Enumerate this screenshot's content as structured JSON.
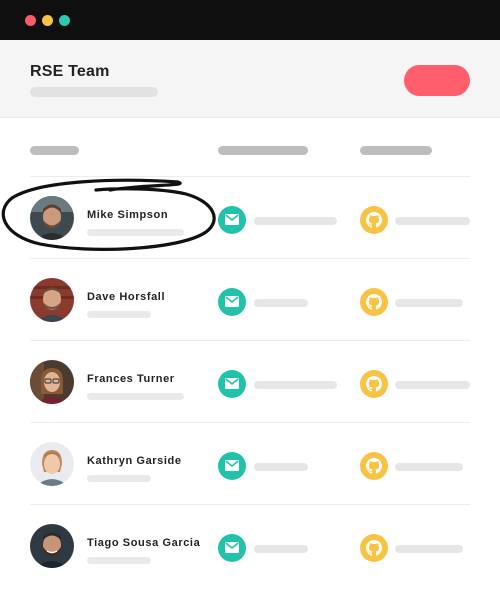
{
  "window": {
    "controls": [
      "close",
      "minimize",
      "maximize"
    ],
    "colors": {
      "close": "#ff5a6a",
      "minimize": "#f6c244",
      "maximize": "#2ec7b1"
    }
  },
  "header": {
    "title": "RSE Team",
    "accent_color": "#ff5f6d"
  },
  "members": [
    {
      "name": "Mike Simpson",
      "highlighted": true
    },
    {
      "name": "Dave Horsfall"
    },
    {
      "name": "Frances Turner"
    },
    {
      "name": "Kathryn Garside"
    },
    {
      "name": "Tiago Sousa Garcia"
    }
  ],
  "icons": {
    "mail": "mail-icon",
    "github": "github-icon",
    "mail_color": "#22c1a9",
    "github_color": "#f7c344"
  }
}
